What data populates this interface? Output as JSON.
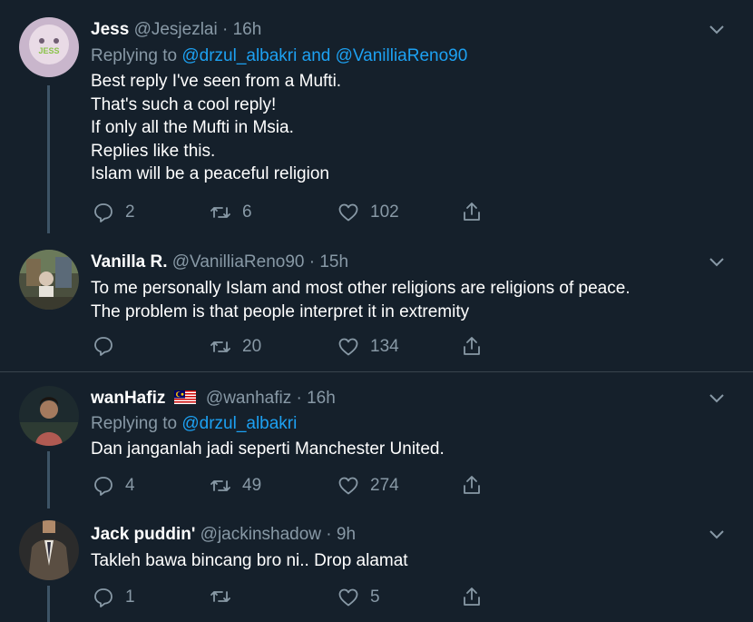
{
  "tweets": [
    {
      "name": "Jess",
      "handle": "@Jesjezlai",
      "time": "· 16h",
      "replying_prefix": "Replying to ",
      "replying_to": "@drzul_albakri and @VanilliaReno90",
      "avatar_label": "JESS",
      "lines": [
        "Best reply I've seen from a Mufti.",
        "That's such a cool reply!",
        "If only all the Mufti in Msia.",
        "Replies like this.",
        "Islam will be a peaceful religion"
      ],
      "replies": "2",
      "retweets": "6",
      "likes": "102"
    },
    {
      "name": "Vanilla R.",
      "handle": "@VanilliaReno90",
      "time": "· 15h",
      "lines": [
        "To me personally Islam and most other religions are religions of peace.",
        "The problem is that people interpret it in extremity"
      ],
      "replies": "",
      "retweets": "20",
      "likes": "134"
    },
    {
      "name": "wanHafiz",
      "handle": "@wanhafiz",
      "time": "· 16h",
      "replying_prefix": "Replying to ",
      "replying_to": "@drzul_albakri",
      "lines": [
        "Dan janganlah jadi seperti Manchester United."
      ],
      "replies": "4",
      "retweets": "49",
      "likes": "274"
    },
    {
      "name": "Jack puddin'",
      "handle": "@jackinshadow",
      "time": "· 9h",
      "lines": [
        "Takleh bawa bincang bro ni.. Drop alamat"
      ],
      "replies": "1",
      "retweets": "",
      "likes": "5"
    }
  ],
  "colors": {
    "background": "#15202b",
    "text": "#ffffff",
    "muted": "#8899a6",
    "link": "#1da1f2",
    "divider": "#38444d"
  }
}
